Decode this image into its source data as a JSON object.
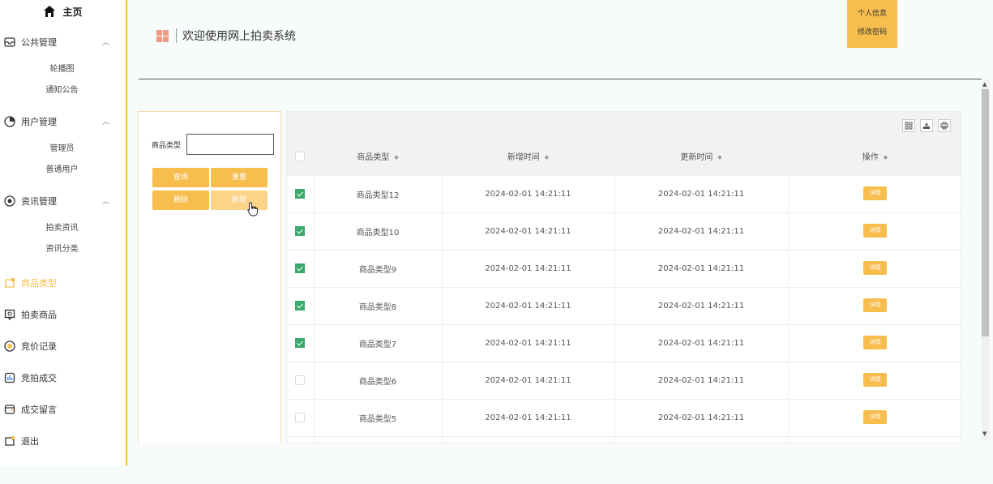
{
  "sidebar": {
    "home_label": "主页",
    "groups": [
      {
        "label": "公共管理",
        "icon": "mail-icon",
        "children": [
          "轮播图",
          "通知公告"
        ]
      },
      {
        "label": "用户管理",
        "icon": "user-circle-icon",
        "children": [
          "管理员",
          "普通用户"
        ]
      },
      {
        "label": "资讯管理",
        "icon": "info-circle-icon",
        "children": [
          "拍卖资讯",
          "资讯分类"
        ]
      }
    ],
    "items": [
      {
        "label": "商品类型",
        "icon": "tag-icon",
        "active": true
      },
      {
        "label": "拍卖商品",
        "icon": "auction-icon"
      },
      {
        "label": "竞价记录",
        "icon": "coin-icon"
      },
      {
        "label": "竞拍成交",
        "icon": "chart-icon"
      },
      {
        "label": "成交留言",
        "icon": "message-icon"
      },
      {
        "label": "退出",
        "icon": "exit-icon"
      }
    ]
  },
  "header": {
    "title": "欢迎使用网上拍卖系统",
    "user_menu": [
      "个人信息",
      "修改密码"
    ]
  },
  "search": {
    "label": "商品类型",
    "value": "",
    "buttons": {
      "query": "查询",
      "reset": "重置",
      "delete": "删除",
      "add": "新增"
    }
  },
  "table": {
    "columns": [
      "商品类型",
      "新增时间",
      "更新时间",
      "操作"
    ],
    "rows": [
      {
        "checked": true,
        "type": "商品类型12",
        "created": "2024-02-01 14:21:11",
        "updated": "2024-02-01 14:21:11",
        "action": "详情"
      },
      {
        "checked": true,
        "type": "商品类型10",
        "created": "2024-02-01 14:21:11",
        "updated": "2024-02-01 14:21:11",
        "action": "详情"
      },
      {
        "checked": true,
        "type": "商品类型9",
        "created": "2024-02-01 14:21:11",
        "updated": "2024-02-01 14:21:11",
        "action": "详情"
      },
      {
        "checked": true,
        "type": "商品类型8",
        "created": "2024-02-01 14:21:11",
        "updated": "2024-02-01 14:21:11",
        "action": "详情"
      },
      {
        "checked": true,
        "type": "商品类型7",
        "created": "2024-02-01 14:21:11",
        "updated": "2024-02-01 14:21:11",
        "action": "详情"
      },
      {
        "checked": false,
        "type": "商品类型6",
        "created": "2024-02-01 14:21:11",
        "updated": "2024-02-01 14:21:11",
        "action": "详情"
      },
      {
        "checked": false,
        "type": "商品类型5",
        "created": "2024-02-01 14:21:11",
        "updated": "2024-02-01 14:21:11",
        "action": "详情"
      },
      {
        "checked": false,
        "type": "",
        "created": "",
        "updated": "",
        "action": ""
      }
    ]
  },
  "colors": {
    "accent": "#f7bd4d",
    "check": "#3aaa6b",
    "title_icon": "#ef9a82"
  }
}
